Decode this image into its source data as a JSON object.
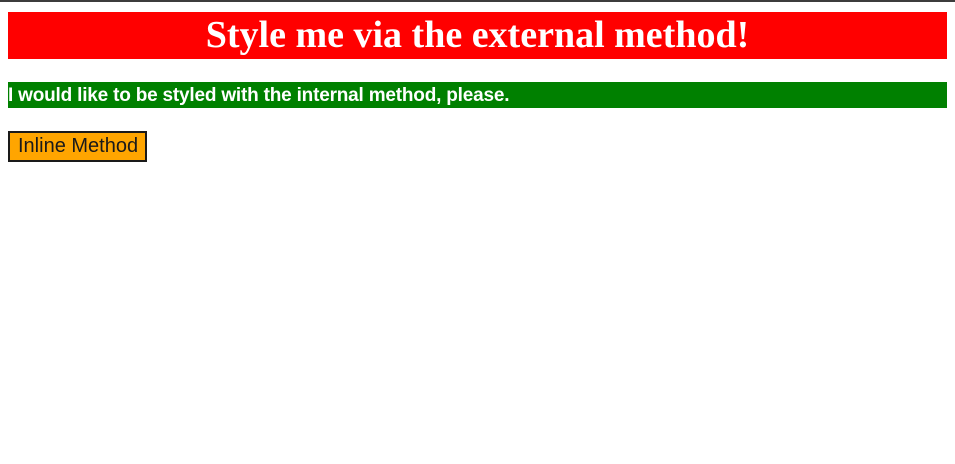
{
  "external": {
    "heading": "Style me via the external method!"
  },
  "internal": {
    "heading": "I would like to be styled with the internal method, please."
  },
  "inline": {
    "button_label": "Inline Method"
  },
  "colors": {
    "external_bg": "#ff0000",
    "internal_bg": "#008000",
    "inline_bg": "#ffa500",
    "text_light": "#ffffff"
  }
}
